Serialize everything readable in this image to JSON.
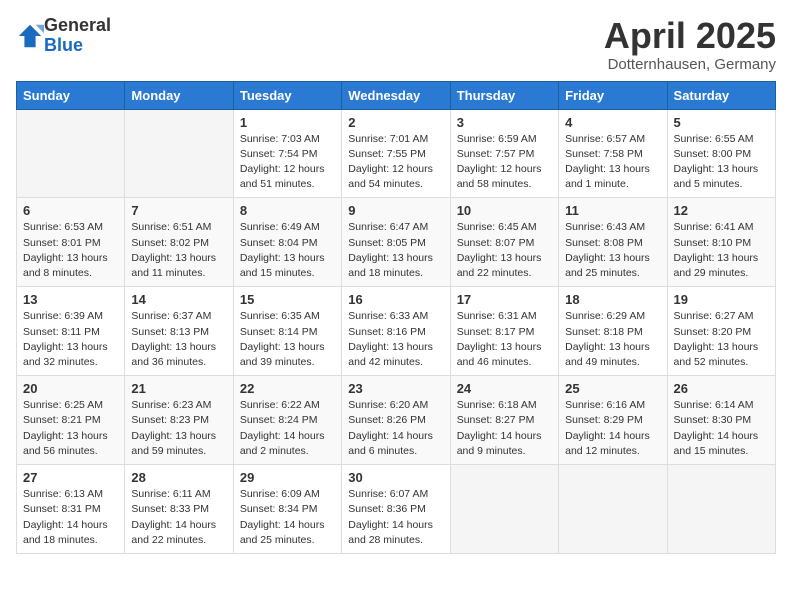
{
  "header": {
    "logo_general": "General",
    "logo_blue": "Blue",
    "month_title": "April 2025",
    "subtitle": "Dotternhausen, Germany"
  },
  "weekdays": [
    "Sunday",
    "Monday",
    "Tuesday",
    "Wednesday",
    "Thursday",
    "Friday",
    "Saturday"
  ],
  "weeks": [
    [
      {
        "day": "",
        "info": ""
      },
      {
        "day": "",
        "info": ""
      },
      {
        "day": "1",
        "info": "Sunrise: 7:03 AM\nSunset: 7:54 PM\nDaylight: 12 hours and 51 minutes."
      },
      {
        "day": "2",
        "info": "Sunrise: 7:01 AM\nSunset: 7:55 PM\nDaylight: 12 hours and 54 minutes."
      },
      {
        "day": "3",
        "info": "Sunrise: 6:59 AM\nSunset: 7:57 PM\nDaylight: 12 hours and 58 minutes."
      },
      {
        "day": "4",
        "info": "Sunrise: 6:57 AM\nSunset: 7:58 PM\nDaylight: 13 hours and 1 minute."
      },
      {
        "day": "5",
        "info": "Sunrise: 6:55 AM\nSunset: 8:00 PM\nDaylight: 13 hours and 5 minutes."
      }
    ],
    [
      {
        "day": "6",
        "info": "Sunrise: 6:53 AM\nSunset: 8:01 PM\nDaylight: 13 hours and 8 minutes."
      },
      {
        "day": "7",
        "info": "Sunrise: 6:51 AM\nSunset: 8:02 PM\nDaylight: 13 hours and 11 minutes."
      },
      {
        "day": "8",
        "info": "Sunrise: 6:49 AM\nSunset: 8:04 PM\nDaylight: 13 hours and 15 minutes."
      },
      {
        "day": "9",
        "info": "Sunrise: 6:47 AM\nSunset: 8:05 PM\nDaylight: 13 hours and 18 minutes."
      },
      {
        "day": "10",
        "info": "Sunrise: 6:45 AM\nSunset: 8:07 PM\nDaylight: 13 hours and 22 minutes."
      },
      {
        "day": "11",
        "info": "Sunrise: 6:43 AM\nSunset: 8:08 PM\nDaylight: 13 hours and 25 minutes."
      },
      {
        "day": "12",
        "info": "Sunrise: 6:41 AM\nSunset: 8:10 PM\nDaylight: 13 hours and 29 minutes."
      }
    ],
    [
      {
        "day": "13",
        "info": "Sunrise: 6:39 AM\nSunset: 8:11 PM\nDaylight: 13 hours and 32 minutes."
      },
      {
        "day": "14",
        "info": "Sunrise: 6:37 AM\nSunset: 8:13 PM\nDaylight: 13 hours and 36 minutes."
      },
      {
        "day": "15",
        "info": "Sunrise: 6:35 AM\nSunset: 8:14 PM\nDaylight: 13 hours and 39 minutes."
      },
      {
        "day": "16",
        "info": "Sunrise: 6:33 AM\nSunset: 8:16 PM\nDaylight: 13 hours and 42 minutes."
      },
      {
        "day": "17",
        "info": "Sunrise: 6:31 AM\nSunset: 8:17 PM\nDaylight: 13 hours and 46 minutes."
      },
      {
        "day": "18",
        "info": "Sunrise: 6:29 AM\nSunset: 8:18 PM\nDaylight: 13 hours and 49 minutes."
      },
      {
        "day": "19",
        "info": "Sunrise: 6:27 AM\nSunset: 8:20 PM\nDaylight: 13 hours and 52 minutes."
      }
    ],
    [
      {
        "day": "20",
        "info": "Sunrise: 6:25 AM\nSunset: 8:21 PM\nDaylight: 13 hours and 56 minutes."
      },
      {
        "day": "21",
        "info": "Sunrise: 6:23 AM\nSunset: 8:23 PM\nDaylight: 13 hours and 59 minutes."
      },
      {
        "day": "22",
        "info": "Sunrise: 6:22 AM\nSunset: 8:24 PM\nDaylight: 14 hours and 2 minutes."
      },
      {
        "day": "23",
        "info": "Sunrise: 6:20 AM\nSunset: 8:26 PM\nDaylight: 14 hours and 6 minutes."
      },
      {
        "day": "24",
        "info": "Sunrise: 6:18 AM\nSunset: 8:27 PM\nDaylight: 14 hours and 9 minutes."
      },
      {
        "day": "25",
        "info": "Sunrise: 6:16 AM\nSunset: 8:29 PM\nDaylight: 14 hours and 12 minutes."
      },
      {
        "day": "26",
        "info": "Sunrise: 6:14 AM\nSunset: 8:30 PM\nDaylight: 14 hours and 15 minutes."
      }
    ],
    [
      {
        "day": "27",
        "info": "Sunrise: 6:13 AM\nSunset: 8:31 PM\nDaylight: 14 hours and 18 minutes."
      },
      {
        "day": "28",
        "info": "Sunrise: 6:11 AM\nSunset: 8:33 PM\nDaylight: 14 hours and 22 minutes."
      },
      {
        "day": "29",
        "info": "Sunrise: 6:09 AM\nSunset: 8:34 PM\nDaylight: 14 hours and 25 minutes."
      },
      {
        "day": "30",
        "info": "Sunrise: 6:07 AM\nSunset: 8:36 PM\nDaylight: 14 hours and 28 minutes."
      },
      {
        "day": "",
        "info": ""
      },
      {
        "day": "",
        "info": ""
      },
      {
        "day": "",
        "info": ""
      }
    ]
  ]
}
